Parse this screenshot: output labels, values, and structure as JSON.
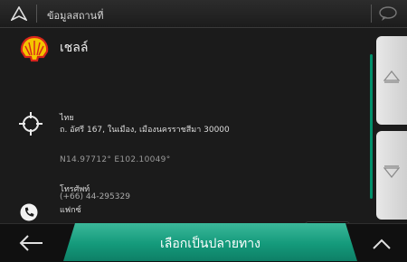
{
  "header": {
    "title": "ข้อมูลสถานที่"
  },
  "place": {
    "name": "เชลล์",
    "country": "ไทย",
    "address": "ถ. อัศรี 167, ในเมือง, เมืองนครราชสีมา 30000",
    "coordinates": "N14.97712° E102.10049°",
    "phone_label": "โทรศัพท์",
    "phone_number": "(+66) 44-295329",
    "fax_label": "แฟกซ์"
  },
  "footer": {
    "primary_button_label": "เลือกเป็นปลายทาง"
  },
  "colors": {
    "accent": "#149a7b",
    "background": "#1b1b1b"
  },
  "icons": [
    "navigation-arrow-icon",
    "chat-bubble-icon",
    "shell-logo",
    "location-crosshair-icon",
    "phone-icon",
    "scroll-up-icon",
    "scroll-down-icon",
    "back-arrow-icon",
    "chevron-up-icon"
  ]
}
